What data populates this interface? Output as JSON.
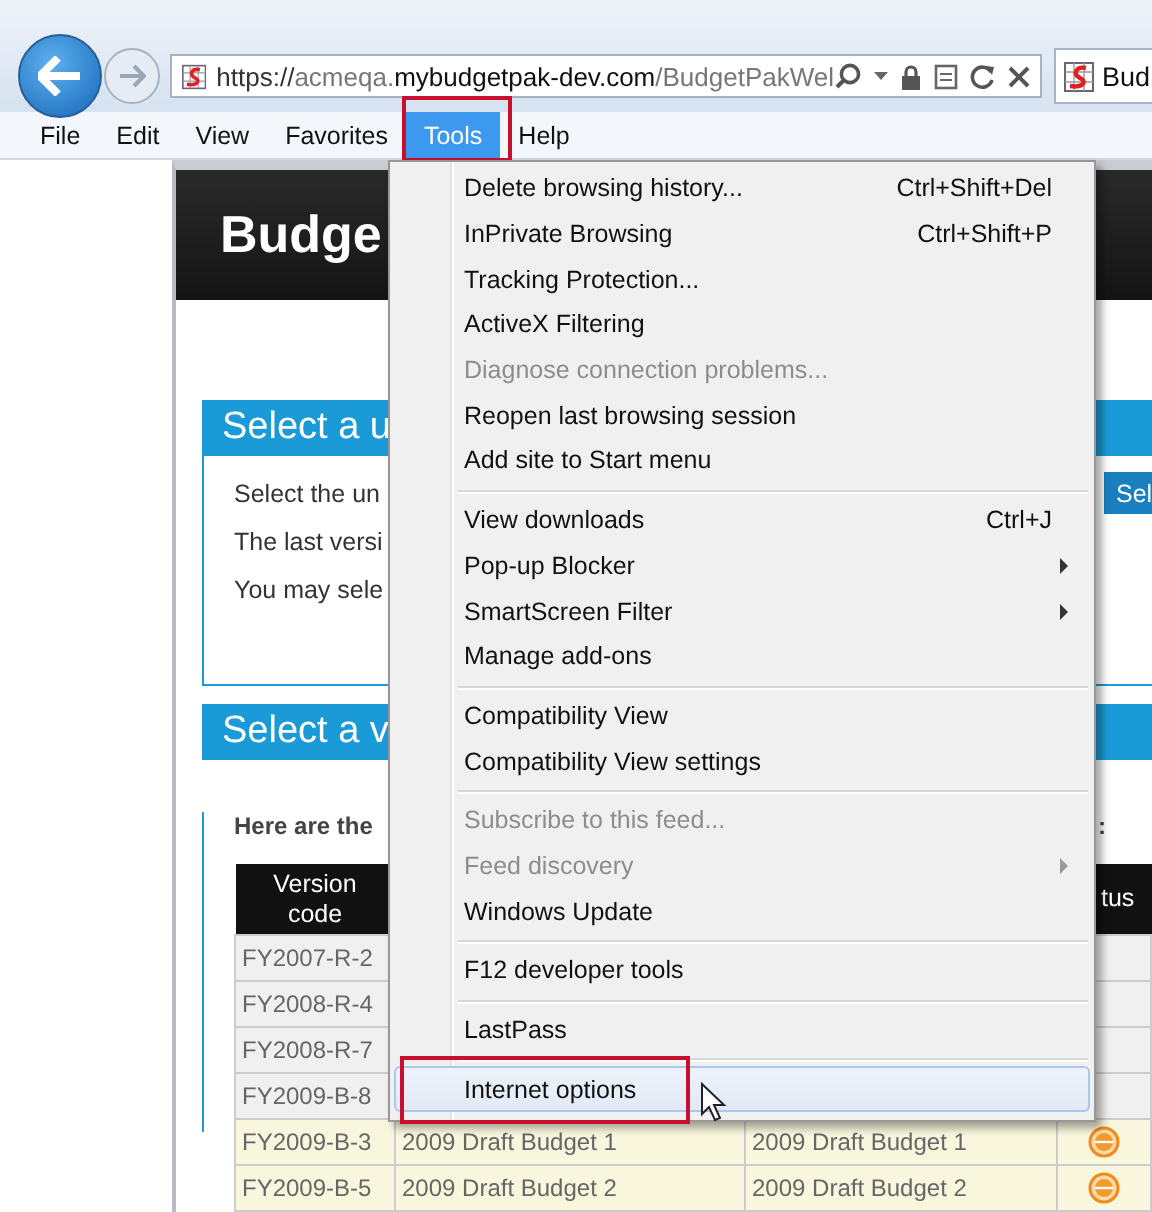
{
  "browser": {
    "address": {
      "scheme": "https://",
      "subdomain": "acmeqa.",
      "domain": "mybudgetpak-dev.com",
      "path": "/BudgetPakWel"
    },
    "tab_title": "Bud"
  },
  "menu_bar": [
    {
      "label": "File",
      "selected": false,
      "annotated": false
    },
    {
      "label": "Edit",
      "selected": false,
      "annotated": false
    },
    {
      "label": "View",
      "selected": false,
      "annotated": false
    },
    {
      "label": "Favorites",
      "selected": false,
      "annotated": false
    },
    {
      "label": "Tools",
      "selected": true,
      "annotated": true
    },
    {
      "label": "Help",
      "selected": false,
      "annotated": false
    }
  ],
  "page": {
    "header_title": "Budge",
    "panels": [
      {
        "title": "Select a u",
        "lines": [
          "Select the un",
          "The last versi",
          "You may sele"
        ],
        "button": "Sel"
      },
      {
        "title": "Select a v",
        "intro": "Here are the",
        "intro_end": ":"
      }
    ],
    "table": {
      "columns": [
        "Version code",
        "tus"
      ],
      "rows": [
        {
          "cells": [
            "FY2007-R-2"
          ],
          "highlighted": false,
          "status_icon": false
        },
        {
          "cells": [
            "FY2008-R-4"
          ],
          "highlighted": false,
          "status_icon": false
        },
        {
          "cells": [
            "FY2008-R-7"
          ],
          "highlighted": false,
          "status_icon": false
        },
        {
          "cells": [
            "FY2009-B-8"
          ],
          "highlighted": false,
          "status_icon": false
        },
        {
          "cells": [
            "FY2009-B-3",
            "2009 Draft Budget 1",
            "2009 Draft Budget 1"
          ],
          "highlighted": true,
          "status_icon": true
        },
        {
          "cells": [
            "FY2009-B-5",
            "2009 Draft Budget 2",
            "2009 Draft Budget 2"
          ],
          "highlighted": true,
          "status_icon": true
        }
      ]
    }
  },
  "tools_menu": {
    "groups": [
      [
        {
          "label": "Delete browsing history...",
          "shortcut": "Ctrl+Shift+Del",
          "submenu": false,
          "disabled": false,
          "selected": false,
          "annotated": false
        },
        {
          "label": "InPrivate Browsing",
          "shortcut": "Ctrl+Shift+P",
          "submenu": false,
          "disabled": false,
          "selected": false,
          "annotated": false
        },
        {
          "label": "Tracking Protection...",
          "submenu": false,
          "disabled": false,
          "selected": false,
          "annotated": false
        },
        {
          "label": "ActiveX Filtering",
          "submenu": false,
          "disabled": false,
          "selected": false,
          "annotated": false
        },
        {
          "label": "Diagnose connection problems...",
          "submenu": false,
          "disabled": true,
          "selected": false,
          "annotated": false
        },
        {
          "label": "Reopen last browsing session",
          "submenu": false,
          "disabled": false,
          "selected": false,
          "annotated": false
        },
        {
          "label": "Add site to Start menu",
          "submenu": false,
          "disabled": false,
          "selected": false,
          "annotated": false
        }
      ],
      [
        {
          "label": "View downloads",
          "shortcut": "Ctrl+J",
          "submenu": false,
          "disabled": false,
          "selected": false,
          "annotated": false
        },
        {
          "label": "Pop-up Blocker",
          "submenu": true,
          "disabled": false,
          "selected": false,
          "annotated": false
        },
        {
          "label": "SmartScreen Filter",
          "submenu": true,
          "disabled": false,
          "selected": false,
          "annotated": false
        },
        {
          "label": "Manage add-ons",
          "submenu": false,
          "disabled": false,
          "selected": false,
          "annotated": false
        }
      ],
      [
        {
          "label": "Compatibility View",
          "submenu": false,
          "disabled": false,
          "selected": false,
          "annotated": false
        },
        {
          "label": "Compatibility View settings",
          "submenu": false,
          "disabled": false,
          "selected": false,
          "annotated": false
        }
      ],
      [
        {
          "label": "Subscribe to this feed...",
          "submenu": false,
          "disabled": true,
          "selected": false,
          "annotated": false
        },
        {
          "label": "Feed discovery",
          "submenu": true,
          "disabled": true,
          "selected": false,
          "annotated": false
        },
        {
          "label": "Windows Update",
          "submenu": false,
          "disabled": false,
          "selected": false,
          "annotated": false
        }
      ],
      [
        {
          "label": "F12 developer tools",
          "submenu": false,
          "disabled": false,
          "selected": false,
          "annotated": false
        }
      ],
      [
        {
          "label": "LastPass",
          "submenu": false,
          "disabled": false,
          "selected": false,
          "annotated": false
        }
      ],
      [
        {
          "label": "Internet options",
          "submenu": false,
          "disabled": false,
          "selected": true,
          "annotated": true
        }
      ]
    ]
  }
}
